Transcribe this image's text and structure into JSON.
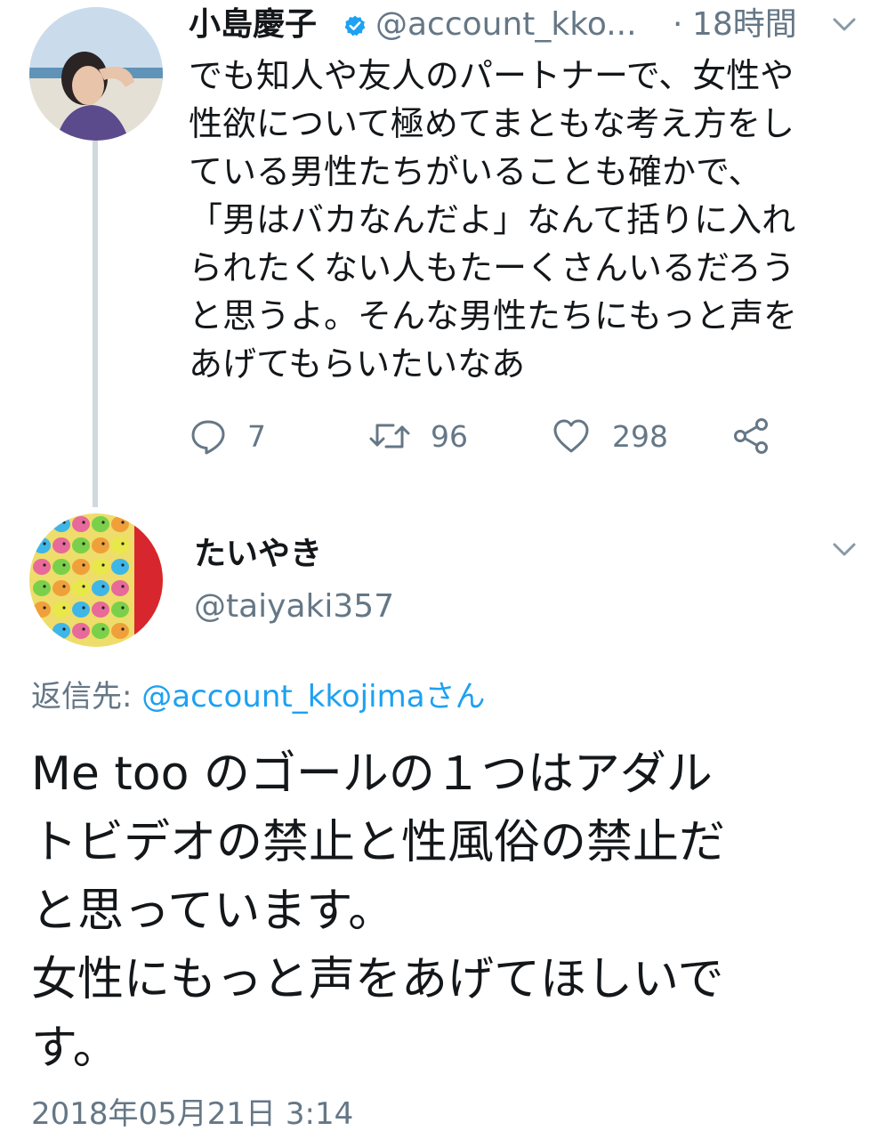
{
  "tweet1": {
    "author_name": "小島慶子",
    "handle": "@account_kko...",
    "time_sep": "·",
    "time": "18時間",
    "verified_icon": "verified-badge-icon",
    "text_lines": [
      "でも知人や友人のパートナーで、女性や",
      "性欲について極めてまともな考え方をし",
      "ている男性たちがいることも確かで、",
      "「男はバカなんだよ」なんて括りに入れ",
      "られたくない人もたーくさんいるだろう",
      "と思うよ。そんな男性たちにもっと声を",
      "あげてもらいたいなあ"
    ],
    "actions": {
      "reply_count": "7",
      "retweet_count": "96",
      "like_count": "298"
    }
  },
  "tweet2": {
    "author_name": "たいやき",
    "handle": "@taiyaki357",
    "reply_label": "返信先: ",
    "reply_target": "@account_kkojimaさん",
    "text_lines": [
      "Me too のゴールの１つはアダル",
      "トビデオの禁止と性風俗の禁止だ",
      "と思っています。",
      "女性にもっと声をあげてほしいで",
      "す。"
    ],
    "timestamp": "2018年05月21日 3:14"
  },
  "colors": {
    "text_primary": "#14171a",
    "text_secondary": "#657786",
    "link": "#1da1f2",
    "verified": "#1da1f2",
    "thread_line": "#cfd9de"
  }
}
